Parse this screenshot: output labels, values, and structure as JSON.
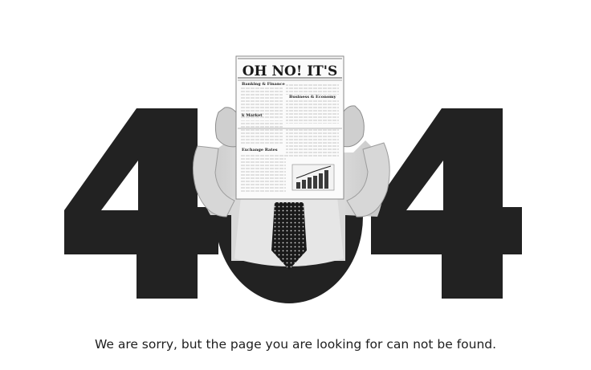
{
  "error": {
    "code_left": "4",
    "code_middle": "0",
    "code_right": "4",
    "message": "We are sorry, but the page you are looking for can not be found."
  },
  "newspaper": {
    "headline": "OH NO! IT'S",
    "sections": {
      "banking": "Banking & Finance",
      "business": "Business & Economy",
      "market": "k Market",
      "exchange": "Exchange Rates"
    }
  },
  "colors": {
    "digit": "#222222",
    "text": "#1e1e1e",
    "background": "#ffffff"
  }
}
